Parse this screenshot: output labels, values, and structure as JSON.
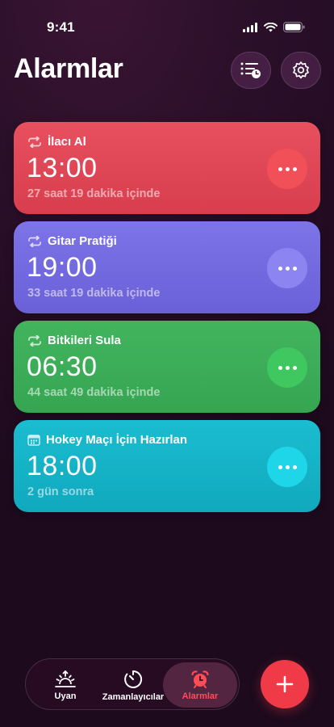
{
  "status": {
    "time": "9:41"
  },
  "header": {
    "title": "Alarmlar"
  },
  "alarms": [
    {
      "label": "İlacı Al",
      "time": "13:00",
      "subtitle": "27 saat 19 dakika içinde",
      "icon": "repeat-icon",
      "color": "#e8505f"
    },
    {
      "label": "Gitar Pratiği",
      "time": "19:00",
      "subtitle": "33 saat 19 dakika içinde",
      "icon": "repeat-icon",
      "color": "#7d74e8"
    },
    {
      "label": "Bitkileri Sula",
      "time": "06:30",
      "subtitle": "44 saat 49 dakika içinde",
      "icon": "repeat-icon",
      "color": "#43b45e"
    },
    {
      "label": "Hokey Maçı İçin Hazırlan",
      "time": "18:00",
      "subtitle": "2 gün sonra",
      "icon": "calendar-icon",
      "color": "#1bbdd0"
    }
  ],
  "tabs": [
    {
      "label": "Uyan",
      "icon": "sunrise-icon"
    },
    {
      "label": "Zamanlayıcılar",
      "icon": "timer-icon"
    },
    {
      "label": "Alarmlar",
      "icon": "alarm-clock-icon",
      "active": true,
      "color": "#ff4d57"
    }
  ],
  "fab": {
    "icon": "plus-icon",
    "color": "#f03a47"
  }
}
